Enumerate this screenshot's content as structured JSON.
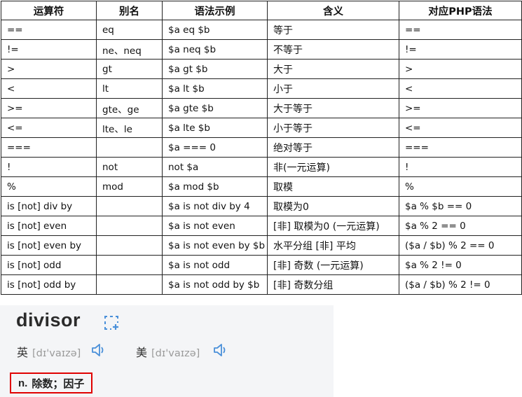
{
  "table": {
    "headers": [
      "运算符",
      "别名",
      "语法示例",
      "含义",
      "对应PHP语法"
    ],
    "rows": [
      [
        "==",
        "eq",
        "$a eq $b",
        "等于",
        "=="
      ],
      [
        "!=",
        "ne、neq",
        "$a neq $b",
        "不等于",
        "!="
      ],
      [
        ">",
        "gt",
        "$a gt $b",
        "大于",
        ">"
      ],
      [
        "<",
        "lt",
        "$a lt $b",
        "小于",
        "<"
      ],
      [
        ">=",
        "gte、ge",
        "$a gte $b",
        "大于等于",
        ">="
      ],
      [
        "<=",
        "lte、le",
        "$a lte $b",
        "小于等于",
        "<="
      ],
      [
        "===",
        "",
        "$a === 0",
        "绝对等于",
        "==="
      ],
      [
        "!",
        "not",
        "not $a",
        "非(一元运算)",
        "!"
      ],
      [
        "%",
        "mod",
        "$a mod $b",
        "取模",
        "%"
      ],
      [
        "is [not] div by",
        "",
        "$a is not div by 4",
        "取模为0",
        "$a % $b == 0"
      ],
      [
        "is [not] even",
        "",
        "$a is not even",
        "[非] 取模为0 (一元运算)",
        "$a % 2 == 0"
      ],
      [
        "is [not] even by",
        "",
        "$a is not even by $b",
        "水平分组 [非] 平均",
        "($a / $b) % 2 == 0"
      ],
      [
        "is [not] odd",
        "",
        "$a is not odd",
        "[非] 奇数 (一元运算)",
        "$a % 2 != 0"
      ],
      [
        "is [not] odd by",
        "",
        "$a is not odd by $b",
        "[非] 奇数分组",
        "($a / $b) % 2 != 0"
      ]
    ]
  },
  "dictionary": {
    "word": "divisor",
    "uk_label": "英",
    "uk_ipa": "[dɪ'vaɪzə]",
    "us_label": "美",
    "us_ipa": "[dɪ'vaɪzə]",
    "pos": "n.",
    "definition": "除数；因子",
    "icons": [
      "add-to-wordbook-icon",
      "speaker-icon"
    ],
    "highlight_color": "#e00000"
  }
}
